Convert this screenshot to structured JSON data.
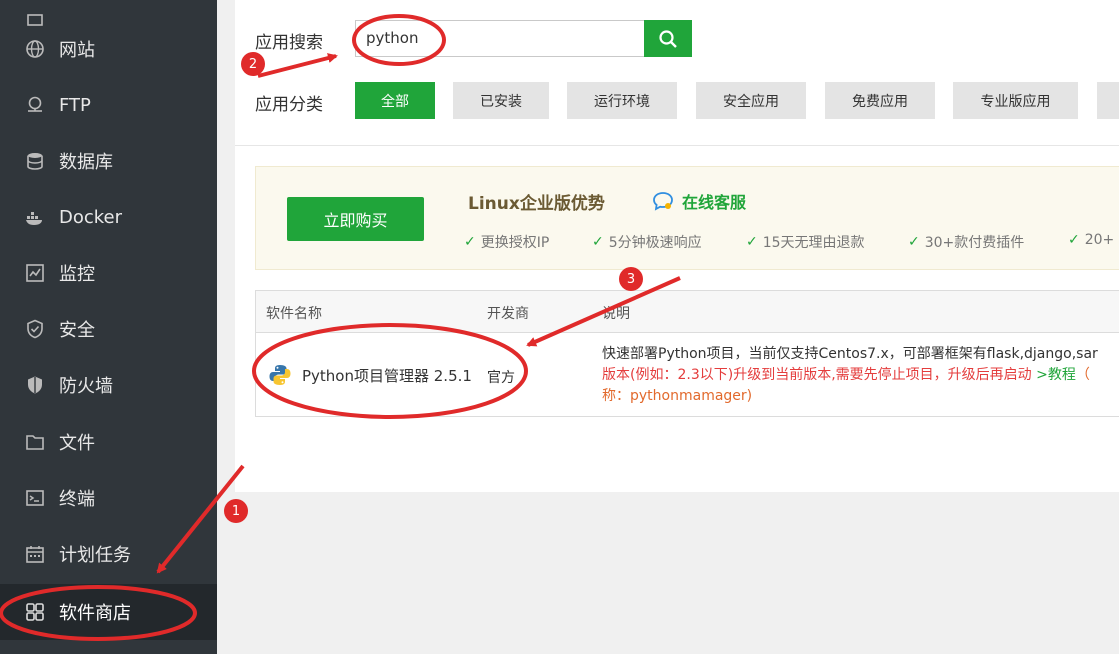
{
  "sidebar": {
    "items": [
      {
        "label": "网站",
        "icon": "globe-icon"
      },
      {
        "label": "FTP",
        "icon": "ftp-icon"
      },
      {
        "label": "数据库",
        "icon": "database-icon"
      },
      {
        "label": "Docker",
        "icon": "docker-icon"
      },
      {
        "label": "监控",
        "icon": "monitor-icon"
      },
      {
        "label": "安全",
        "icon": "shield-check-icon"
      },
      {
        "label": "防火墙",
        "icon": "firewall-shield-icon"
      },
      {
        "label": "文件",
        "icon": "folder-icon"
      },
      {
        "label": "终端",
        "icon": "terminal-icon"
      },
      {
        "label": "计划任务",
        "icon": "calendar-icon"
      },
      {
        "label": "软件商店",
        "icon": "grid-icon",
        "active": true
      }
    ]
  },
  "search": {
    "label": "应用搜索",
    "value": "python"
  },
  "categories": {
    "label": "应用分类",
    "items": [
      "全部",
      "已安装",
      "运行环境",
      "安全应用",
      "免费应用",
      "专业版应用"
    ]
  },
  "promo": {
    "buy_label": "立即购买",
    "title": "Linux企业版优势",
    "service": "在线客服",
    "features": [
      "更换授权IP",
      "5分钟极速响应",
      "15天无理由退款",
      "30+款付费插件",
      "20+"
    ]
  },
  "table": {
    "headers": [
      "软件名称",
      "开发商",
      "说明"
    ],
    "rows": [
      {
        "name": "Python项目管理器 2.5.1",
        "developer": "官方",
        "desc_line1": "快速部署Python项目，当前仅支持Centos7.x，可部署框架有flask,django,sar",
        "desc_line2": "版本(例如：2.3以下)升级到当前版本,需要先停止项目，升级后再启动",
        "desc_tutorial": ">教程",
        "desc_line2_tail": "（",
        "desc_line3": "称：pythonmamager)"
      }
    ]
  },
  "annotations": {
    "badges": [
      "1",
      "2",
      "3"
    ]
  },
  "colors": {
    "accent": "#20a53a",
    "sidebar_bg": "#30363b",
    "annotation_red": "#e02a2a"
  }
}
